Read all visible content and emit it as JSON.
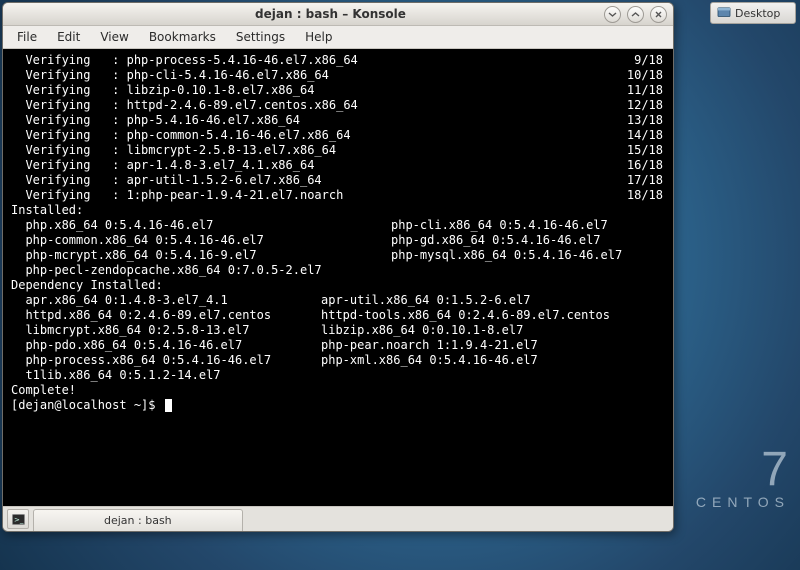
{
  "desktopWallpaper": {
    "centosVersion": "7",
    "centosLabel": "CENTOS"
  },
  "desktopButton": {
    "label": "Desktop"
  },
  "window": {
    "title": "dejan : bash – Konsole",
    "menu": [
      "File",
      "Edit",
      "View",
      "Bookmarks",
      "Settings",
      "Help"
    ],
    "controls": {
      "min": "v",
      "max": "^",
      "close": "x"
    },
    "tab": "dejan : bash"
  },
  "verifying": [
    {
      "pkg": "php-process-5.4.16-46.el7.x86_64",
      "n": "9/18"
    },
    {
      "pkg": "php-cli-5.4.16-46.el7.x86_64",
      "n": "10/18"
    },
    {
      "pkg": "libzip-0.10.1-8.el7.x86_64",
      "n": "11/18"
    },
    {
      "pkg": "httpd-2.4.6-89.el7.centos.x86_64",
      "n": "12/18"
    },
    {
      "pkg": "php-5.4.16-46.el7.x86_64",
      "n": "13/18"
    },
    {
      "pkg": "php-common-5.4.16-46.el7.x86_64",
      "n": "14/18"
    },
    {
      "pkg": "libmcrypt-2.5.8-13.el7.x86_64",
      "n": "15/18"
    },
    {
      "pkg": "apr-1.4.8-3.el7_4.1.x86_64",
      "n": "16/18"
    },
    {
      "pkg": "apr-util-1.5.2-6.el7.x86_64",
      "n": "17/18"
    },
    {
      "pkg": "1:php-pear-1.9.4-21.el7.noarch",
      "n": "18/18"
    }
  ],
  "sections": {
    "installedHeader": "Installed:",
    "depHeader": "Dependency Installed:",
    "complete": "Complete!",
    "prompt": "[dejan@localhost ~]$ "
  },
  "installed": [
    [
      "php.x86_64 0:5.4.16-46.el7",
      "php-cli.x86_64 0:5.4.16-46.el7"
    ],
    [
      "php-common.x86_64 0:5.4.16-46.el7",
      "php-gd.x86_64 0:5.4.16-46.el7"
    ],
    [
      "php-mcrypt.x86_64 0:5.4.16-9.el7",
      "php-mysql.x86_64 0:5.4.16-46.el7"
    ],
    [
      "php-pecl-zendopcache.x86_64 0:7.0.5-2.el7",
      ""
    ]
  ],
  "depInstalled": [
    [
      "apr.x86_64 0:1.4.8-3.el7_4.1",
      "apr-util.x86_64 0:1.5.2-6.el7"
    ],
    [
      "httpd.x86_64 0:2.4.6-89.el7.centos",
      "httpd-tools.x86_64 0:2.4.6-89.el7.centos"
    ],
    [
      "libmcrypt.x86_64 0:2.5.8-13.el7",
      "libzip.x86_64 0:0.10.1-8.el7"
    ],
    [
      "php-pdo.x86_64 0:5.4.16-46.el7",
      "php-pear.noarch 1:1.9.4-21.el7"
    ],
    [
      "php-process.x86_64 0:5.4.16-46.el7",
      "php-xml.x86_64 0:5.4.16-46.el7"
    ],
    [
      "t1lib.x86_64 0:5.1.2-14.el7",
      ""
    ]
  ]
}
